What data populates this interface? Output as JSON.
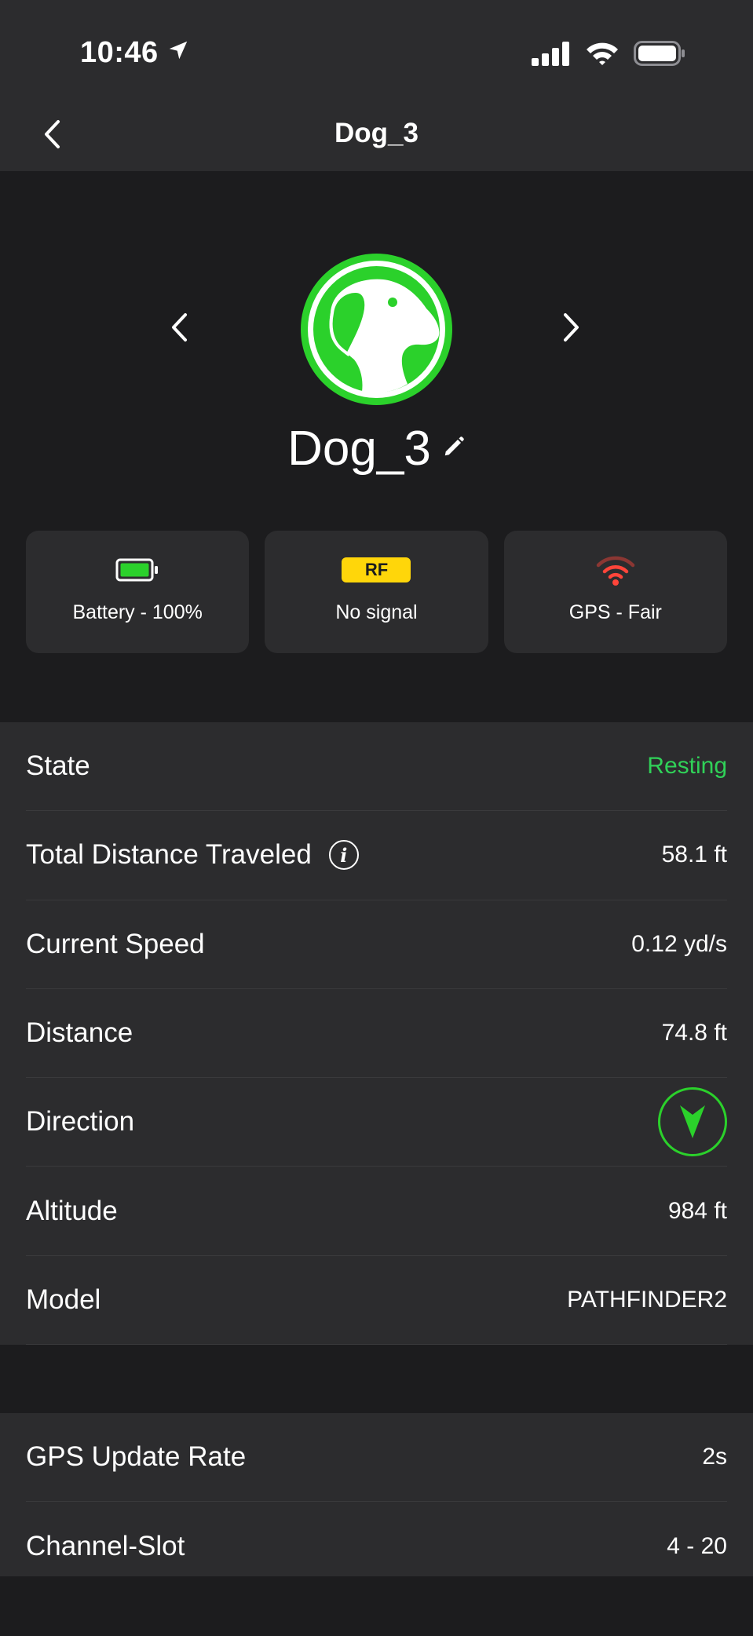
{
  "status_bar": {
    "time": "10:46",
    "icons": [
      "location-arrow-icon",
      "cellular-signal-icon",
      "wifi-icon",
      "battery-icon"
    ]
  },
  "nav": {
    "title": "Dog_3",
    "back_icon": "chevron-left-icon"
  },
  "profile": {
    "name": "Dog_3",
    "avatar_icon": "dog-head-icon",
    "avatar_color": "#2bd12b",
    "prev_icon": "chevron-left-icon",
    "next_icon": "chevron-right-icon",
    "edit_icon": "pencil-icon"
  },
  "status_tiles": [
    {
      "icon": "battery-icon",
      "label": "Battery - 100%",
      "level": 1.0
    },
    {
      "badge": "RF",
      "label": "No signal"
    },
    {
      "icon": "gps-signal-icon",
      "label": "GPS - Fair"
    }
  ],
  "details": [
    {
      "label": "State",
      "value": "Resting",
      "value_color": "#30d158"
    },
    {
      "label": "Total Distance Traveled",
      "value": "58.1 ft",
      "info_icon": "i"
    },
    {
      "label": "Current Speed",
      "value": "0.12 yd/s"
    },
    {
      "label": "Distance",
      "value": "74.8 ft"
    },
    {
      "label": "Direction",
      "icon": "direction-arrow-icon"
    },
    {
      "label": "Altitude",
      "value": "984 ft"
    },
    {
      "label": "Model",
      "value": "PATHFINDER2"
    }
  ],
  "settings": [
    {
      "label": "GPS Update Rate",
      "value": "2s"
    },
    {
      "label": "Channel-Slot",
      "value": "4 - 20"
    }
  ],
  "colors": {
    "accent_green": "#2bd12b",
    "rf_yellow": "#ffd60a",
    "gps_red": "#ff453a"
  }
}
